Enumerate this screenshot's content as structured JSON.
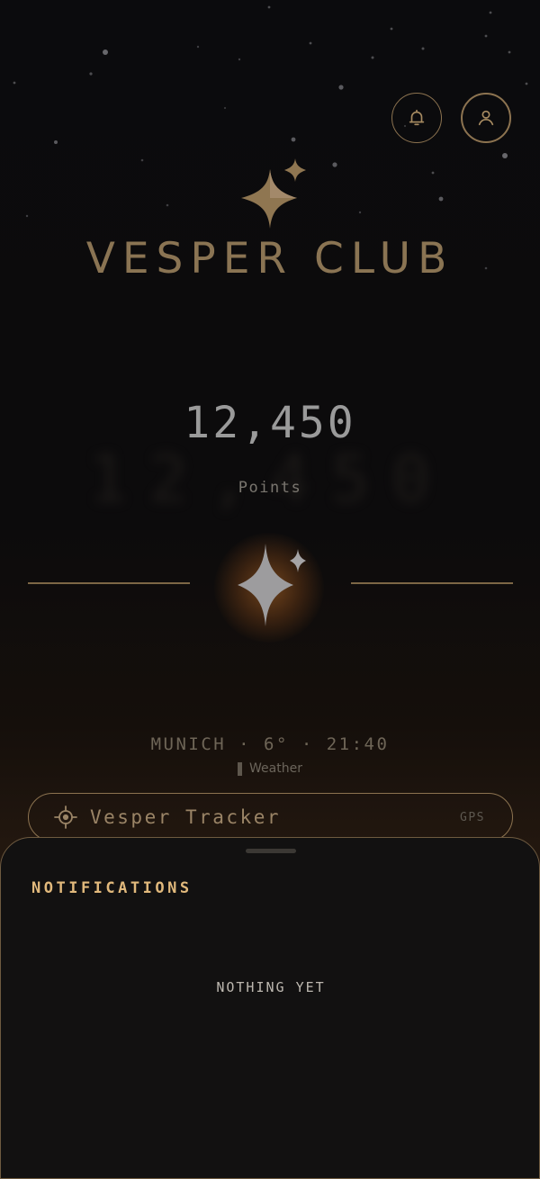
{
  "header": {
    "notifications_icon": "bell-icon",
    "profile_icon": "user-icon"
  },
  "brand": {
    "logo_icon": "sparkle-icon",
    "name": "VESPER CLUB"
  },
  "points": {
    "value": "12,450",
    "label": "Points"
  },
  "status": {
    "line": "MUNICH · 6° · 21:40",
    "weather_label": "Weather"
  },
  "tracker": {
    "icon": "crosshair-icon",
    "label": "Vesper Tracker",
    "tag": "GPS"
  },
  "notifications_sheet": {
    "title": "NOTIFICATIONS",
    "empty_message": "NOTHING YET"
  },
  "colors": {
    "accent_gold": "#8c7350",
    "title_gold": "#e1b97c",
    "background": "#0b0b0d",
    "sheet_background": "#121111"
  }
}
